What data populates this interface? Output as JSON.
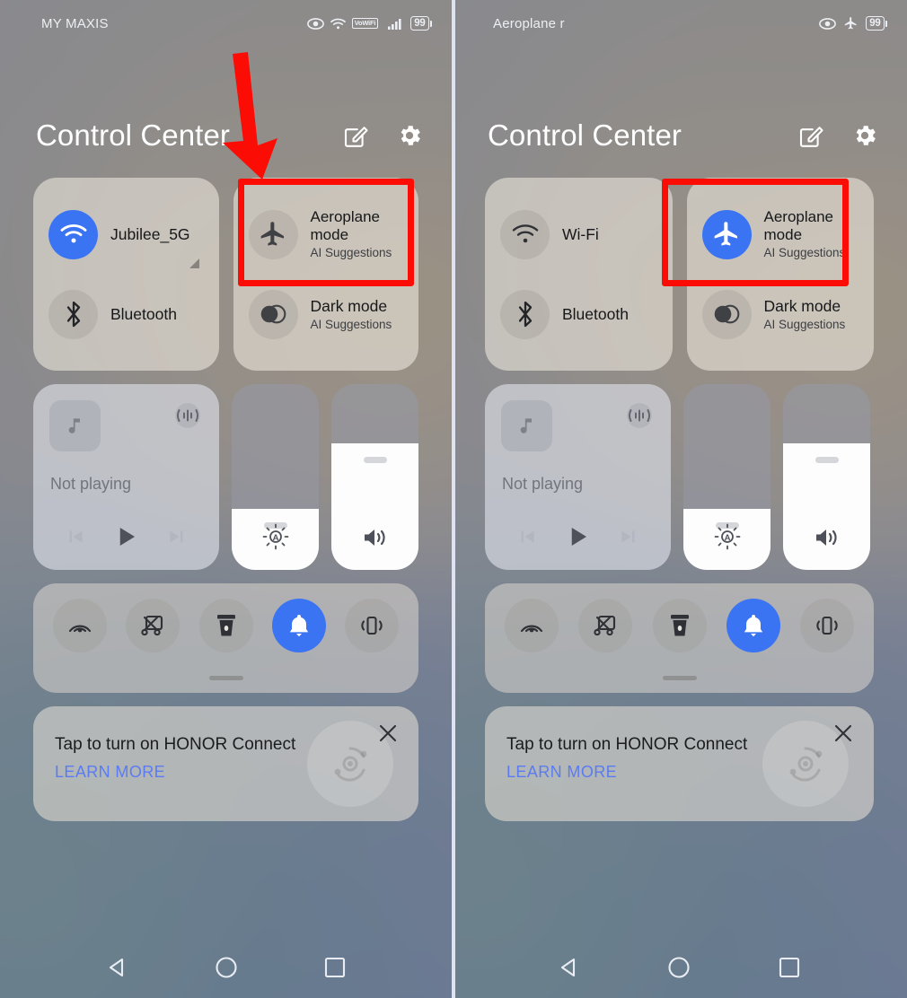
{
  "left_panel": {
    "status_bar": {
      "carrier": "MY MAXIS",
      "battery_level": "99",
      "icons": [
        "eye-icon",
        "wifi-icon",
        "vowifi-badge",
        "signal-bars-icon",
        "battery-icon"
      ],
      "vowifi_label": "VoWiFi"
    },
    "header": {
      "title": "Control Center",
      "edit_label": "Edit",
      "settings_label": "Settings"
    },
    "toggles": [
      {
        "name": "wifi",
        "label": "Jubilee_5G",
        "sub": "",
        "icon": "wifi-icon",
        "active": true,
        "expandable": true
      },
      {
        "name": "bluetooth",
        "label": "Bluetooth",
        "sub": "",
        "icon": "bluetooth-icon",
        "active": false,
        "expandable": false
      },
      {
        "name": "aeroplane-mode",
        "label": "Aeroplane mode",
        "sub": "AI Suggestions",
        "icon": "airplane-icon",
        "active": false,
        "expandable": false
      },
      {
        "name": "dark-mode",
        "label": "Dark mode",
        "sub": "AI Suggestions",
        "icon": "dark-mode-icon",
        "active": false,
        "expandable": false
      }
    ],
    "media": {
      "status": "Not playing",
      "cast_icon": "audio-output-icon",
      "prev": "Previous",
      "play": "Play",
      "next": "Next"
    },
    "brightness": {
      "name": "brightness-slider",
      "value_pct": 33,
      "icon": "auto-brightness-icon"
    },
    "volume": {
      "name": "volume-slider",
      "value_pct": 68,
      "icon": "volume-icon"
    },
    "quick_actions": [
      {
        "name": "screencast",
        "icon": "screencast-icon",
        "active": false
      },
      {
        "name": "screenshot",
        "icon": "screenshot-scissors-icon",
        "active": false
      },
      {
        "name": "flashlight",
        "icon": "flashlight-icon",
        "active": false
      },
      {
        "name": "ring-mode",
        "icon": "bell-icon",
        "active": true
      },
      {
        "name": "vibrate",
        "icon": "vibrate-icon",
        "active": false
      }
    ],
    "banner": {
      "title": "Tap to turn on HONOR Connect",
      "link": "LEARN MORE",
      "close": "Close"
    },
    "nav": {
      "back": "Back",
      "home": "Home",
      "recents": "Recents"
    }
  },
  "right_panel": {
    "status_bar": {
      "carrier": "Aeroplane r",
      "battery_level": "99",
      "icons": [
        "eye-icon",
        "airplane-icon",
        "battery-icon"
      ]
    },
    "header": {
      "title": "Control Center",
      "edit_label": "Edit",
      "settings_label": "Settings"
    },
    "toggles": [
      {
        "name": "wifi",
        "label": "Wi-Fi",
        "sub": "",
        "icon": "wifi-icon",
        "active": false,
        "expandable": false
      },
      {
        "name": "bluetooth",
        "label": "Bluetooth",
        "sub": "",
        "icon": "bluetooth-icon",
        "active": false,
        "expandable": false
      },
      {
        "name": "aeroplane-mode",
        "label": "Aeroplane mode",
        "sub": "AI Suggestions",
        "icon": "airplane-icon",
        "active": true,
        "expandable": false
      },
      {
        "name": "dark-mode",
        "label": "Dark mode",
        "sub": "AI Suggestions",
        "icon": "dark-mode-icon",
        "active": false,
        "expandable": false
      }
    ],
    "media": {
      "status": "Not playing",
      "cast_icon": "audio-output-icon",
      "prev": "Previous",
      "play": "Play",
      "next": "Next"
    },
    "brightness": {
      "name": "brightness-slider",
      "value_pct": 33,
      "icon": "auto-brightness-icon"
    },
    "volume": {
      "name": "volume-slider",
      "value_pct": 68,
      "icon": "volume-icon"
    },
    "quick_actions": [
      {
        "name": "screencast",
        "icon": "screencast-icon",
        "active": false
      },
      {
        "name": "screenshot",
        "icon": "screenshot-scissors-icon",
        "active": false
      },
      {
        "name": "flashlight",
        "icon": "flashlight-icon",
        "active": false
      },
      {
        "name": "ring-mode",
        "icon": "bell-icon",
        "active": true
      },
      {
        "name": "vibrate",
        "icon": "vibrate-icon",
        "active": false
      }
    ],
    "banner": {
      "title": "Tap to turn on HONOR Connect",
      "link": "LEARN MORE",
      "close": "Close"
    },
    "nav": {
      "back": "Back",
      "home": "Home",
      "recents": "Recents"
    }
  },
  "annotations": {
    "highlight_color": "#fb0d06",
    "arrow": {
      "name": "red-down-arrow",
      "points_to": "aeroplane-mode-tile"
    },
    "boxes": [
      {
        "name": "highlight-box-left-aeroplane",
        "target": "aeroplane-mode-tile"
      },
      {
        "name": "highlight-box-right-aeroplane",
        "target": "aeroplane-mode-tile"
      }
    ]
  },
  "accents": {
    "active_blue": "#3b74f2",
    "link_blue": "#5b7cf0"
  }
}
